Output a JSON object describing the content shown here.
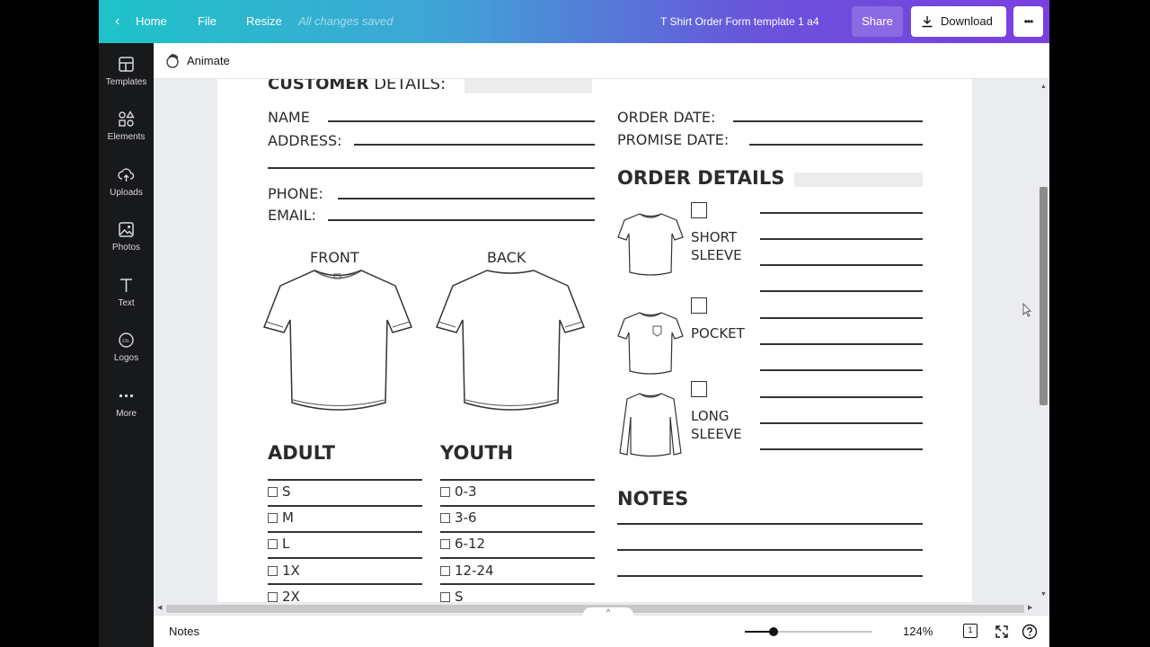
{
  "topbar": {
    "home": "Home",
    "file": "File",
    "resize": "Resize",
    "save_status": "All changes saved",
    "doc_title": "T Shirt Order Form template 1 a4",
    "share": "Share",
    "download": "Download",
    "more": "•••"
  },
  "sidebar": {
    "items": [
      {
        "label": "Templates",
        "icon": "templates-icon"
      },
      {
        "label": "Elements",
        "icon": "elements-icon"
      },
      {
        "label": "Uploads",
        "icon": "uploads-icon"
      },
      {
        "label": "Photos",
        "icon": "photos-icon"
      },
      {
        "label": "Text",
        "icon": "text-icon"
      },
      {
        "label": "Logos",
        "icon": "logos-icon"
      },
      {
        "label": "More",
        "icon": "more-icon"
      }
    ]
  },
  "animate": "Animate",
  "form": {
    "customer_bold": "CUSTOMER",
    "customer_rest": "DETAILS:",
    "name": "NAME",
    "address": "ADDRESS:",
    "phone": "PHONE:",
    "email": "EMAIL:",
    "order_date": "ORDER DATE:",
    "promise_date": "PROMISE DATE:",
    "order_details": "ORDER DETAILS",
    "front": "FRONT",
    "back": "BACK",
    "short_sleeve_1": "SHORT",
    "short_sleeve_2": "SLEEVE",
    "pocket": "POCKET",
    "long_sleeve_1": "LONG",
    "long_sleeve_2": "SLEEVE",
    "adult": "ADULT",
    "youth": "YOUTH",
    "notes": "NOTES",
    "adult_sizes": [
      "S",
      "M",
      "L",
      "1X",
      "2X"
    ],
    "youth_sizes": [
      "0-3",
      "3-6",
      "6-12",
      "12-24",
      "S"
    ]
  },
  "bottombar": {
    "notes": "Notes",
    "zoom": "124%",
    "page_num": "1"
  }
}
